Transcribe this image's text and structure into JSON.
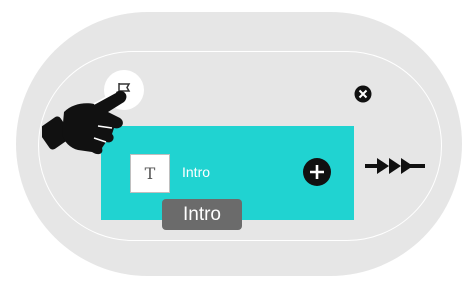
{
  "node": {
    "label": "Intro",
    "icon": "text-icon",
    "icon_glyph": "T"
  },
  "tooltip": {
    "text": "Intro"
  },
  "icons": {
    "start": "flag-icon",
    "close": "close-icon",
    "add": "plus-icon",
    "next": "arrow-right-icon",
    "pointer": "hand-pointer-icon"
  },
  "colors": {
    "node": "#20d3d1",
    "track": "#e6e6e6",
    "tooltip": "#6b6b6b"
  }
}
